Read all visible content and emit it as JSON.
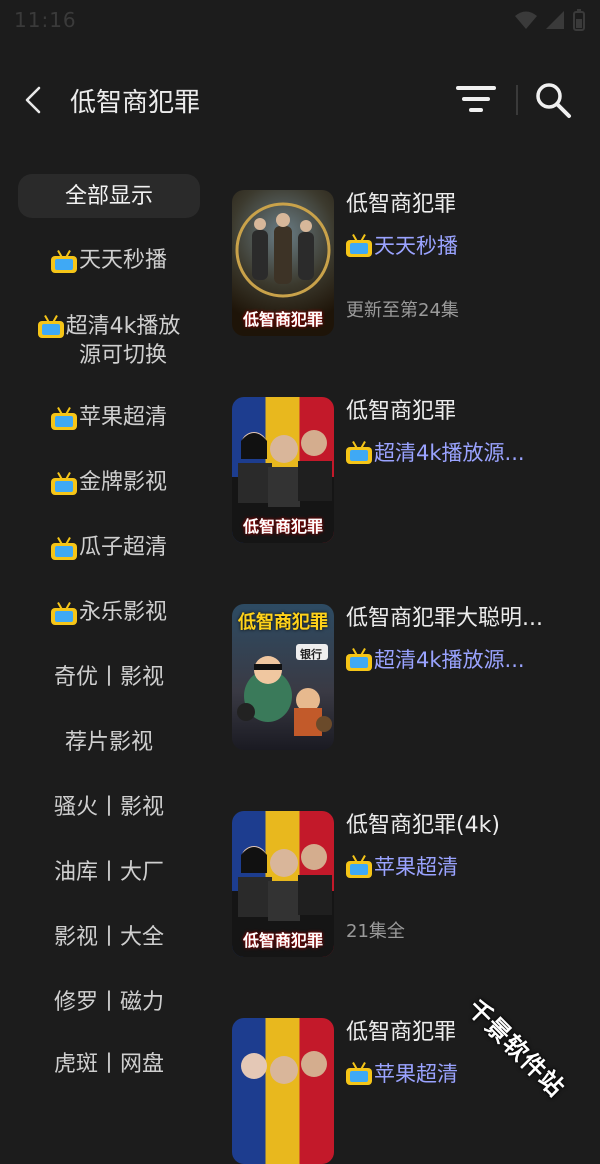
{
  "status_bar": {
    "time": "11:16"
  },
  "header": {
    "title": "低智商犯罪"
  },
  "sidebar": {
    "items": [
      {
        "label": "全部显示",
        "tv": false,
        "active": true
      },
      {
        "label": "天天秒播",
        "tv": true
      },
      {
        "label": "超清4k播放源可切换",
        "line1": "超清4k播放",
        "line2": "源可切换",
        "tv": true
      },
      {
        "label": "苹果超清",
        "tv": true
      },
      {
        "label": "金牌影视",
        "tv": true
      },
      {
        "label": "瓜子超清",
        "tv": true
      },
      {
        "label": "永乐影视",
        "tv": true
      },
      {
        "label": "奇优丨影视",
        "tv": false
      },
      {
        "label": "荐片影视",
        "tv": false
      },
      {
        "label": "骚火丨影视",
        "tv": false
      },
      {
        "label": "油库丨大厂",
        "tv": false
      },
      {
        "label": "影视丨大全",
        "tv": false
      },
      {
        "label": "修罗丨磁力",
        "tv": false
      },
      {
        "label": "虎斑丨网盘",
        "tv": false
      }
    ]
  },
  "results": [
    {
      "title": "低智商犯罪",
      "source": "天天秒播",
      "status": "更新至第24集",
      "poster_text": "低智商犯罪"
    },
    {
      "title": "低智商犯罪",
      "source": "超清4k播放源...",
      "status": "",
      "poster_text": "低智商犯罪"
    },
    {
      "title": "低智商犯罪大聪明...",
      "source": "超清4k播放源...",
      "status": "",
      "poster_text": "低智商犯罪",
      "poster_top": "低智商犯罪",
      "poster_badge": "银行"
    },
    {
      "title": "低智商犯罪(4k)",
      "source": "苹果超清",
      "status": "21集全",
      "poster_text": "低智商犯罪"
    },
    {
      "title": "低智商犯罪",
      "source": "苹果超清",
      "status": "",
      "poster_text": ""
    }
  ],
  "watermark": "千景软件站",
  "colors": {
    "background": "#1c1c1c",
    "source_link": "#9aa3ff",
    "tv_icon": "#f5c518"
  }
}
